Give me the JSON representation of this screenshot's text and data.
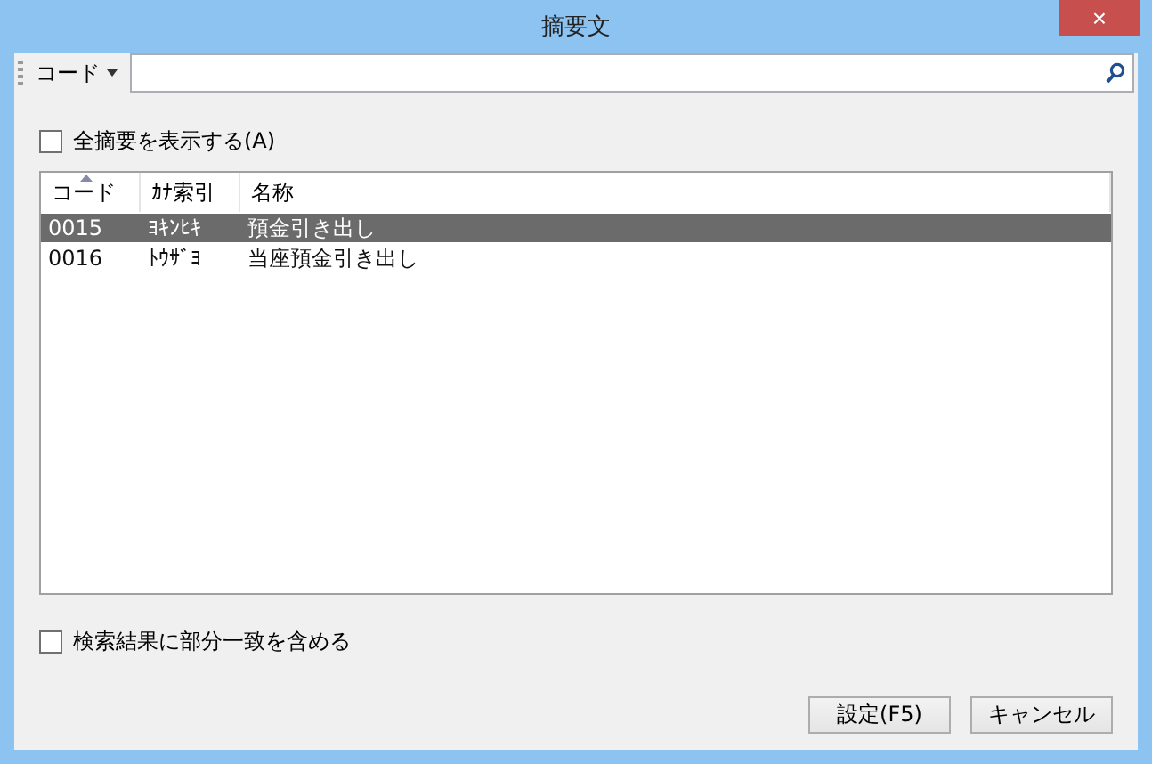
{
  "window": {
    "title": "摘要文",
    "close": "×"
  },
  "search": {
    "field_menu": "コード"
  },
  "show_all": {
    "label": "全摘要を表示する(A)",
    "checked": false
  },
  "table": {
    "columns": [
      {
        "label": "コード",
        "sorted": true
      },
      {
        "label": "ｶﾅ索引",
        "sorted": false
      },
      {
        "label": "名称",
        "sorted": false
      }
    ],
    "rows": [
      {
        "cells": [
          "0015",
          "ﾖｷﾝﾋｷ",
          "預金引き出し"
        ],
        "selected": true
      },
      {
        "cells": [
          "0016",
          "ﾄｳｻﾞﾖ",
          "当座預金引き出し"
        ],
        "selected": false
      }
    ]
  },
  "partial_match": {
    "label": "検索結果に部分一致を含める",
    "checked": false
  },
  "buttons": [
    "設定(F5)",
    "キャンセル"
  ]
}
